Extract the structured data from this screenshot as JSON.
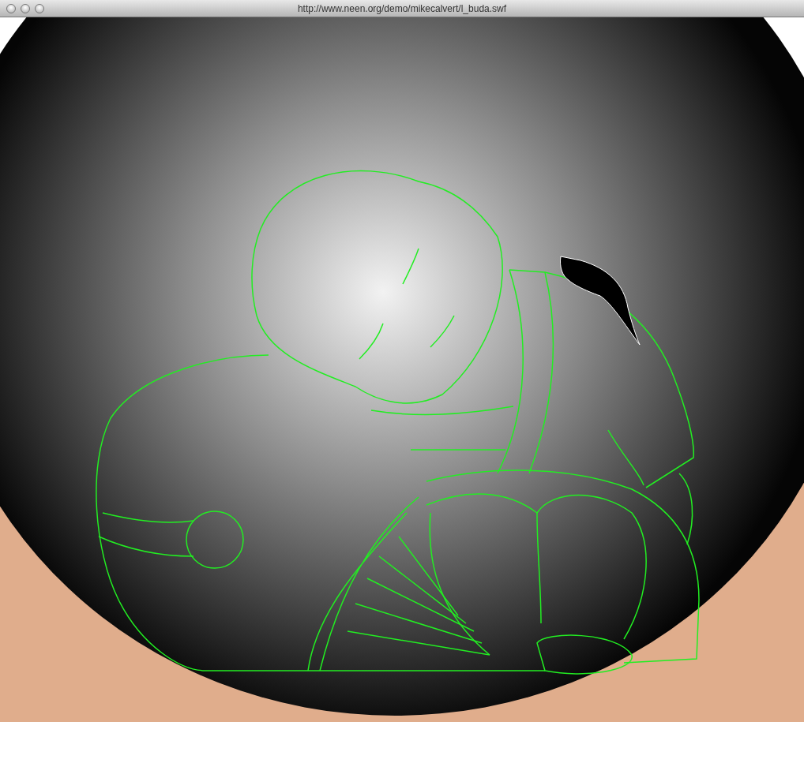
{
  "window": {
    "title": "http://www.neen.org/demo/mikecalvert/l_buda.swf"
  }
}
